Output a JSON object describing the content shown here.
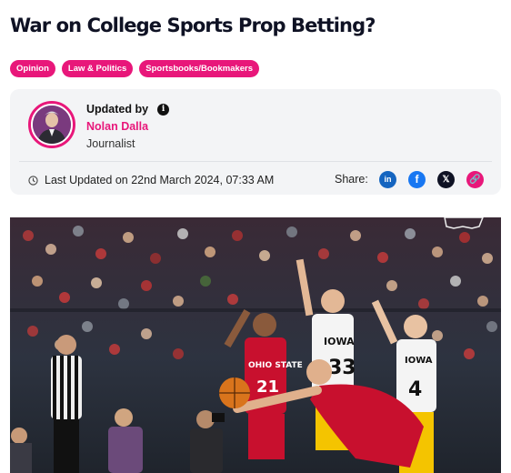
{
  "article": {
    "title": "War on College Sports Prop Betting?",
    "tags": [
      "Opinion",
      "Law & Politics",
      "Sportsbooks/Bookmakers"
    ]
  },
  "author_card": {
    "updated_by_label": "Updated by",
    "author_name": "Nolan Dalla",
    "author_role": "Journalist",
    "last_updated": "Last Updated on 22nd March 2024, 07:33 AM",
    "share_label": "Share:",
    "share_buttons": [
      {
        "icon": "linkedin-icon",
        "glyph": "in"
      },
      {
        "icon": "facebook-icon",
        "glyph": "f"
      },
      {
        "icon": "x-icon",
        "glyph": "𝕏"
      },
      {
        "icon": "link-icon",
        "glyph": "🔗"
      }
    ]
  },
  "hero_image": {
    "jersey_red_text": "OHIO STATE",
    "jersey_red_number": "21",
    "jersey_white_text": "IOWA",
    "jersey_white_number": "33",
    "jersey_white_number_2": "4"
  },
  "colors": {
    "accent": "#e8177a",
    "title": "#0f1224",
    "card_bg": "#f3f4f6"
  }
}
